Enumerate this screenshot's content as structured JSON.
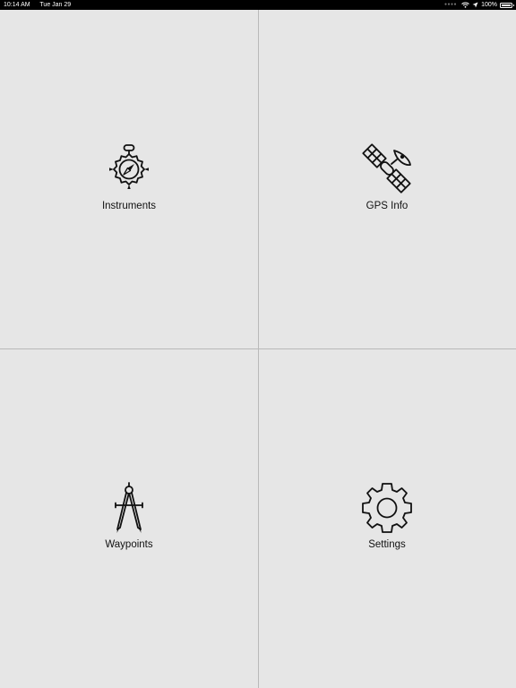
{
  "status_bar": {
    "time": "10:14 AM",
    "date": "Tue Jan 29",
    "battery": "100%",
    "battery_level": 1.0
  },
  "tiles": [
    {
      "label": "Instruments",
      "icon": "compass-icon"
    },
    {
      "label": "GPS Info",
      "icon": "satellite-icon"
    },
    {
      "label": "Waypoints",
      "icon": "divider-compass-icon"
    },
    {
      "label": "Settings",
      "icon": "gear-icon"
    }
  ],
  "colors": {
    "background": "#e6e6e6",
    "divider": "#b9b9b9",
    "icon": "#111111",
    "status_bar": "#000000"
  }
}
